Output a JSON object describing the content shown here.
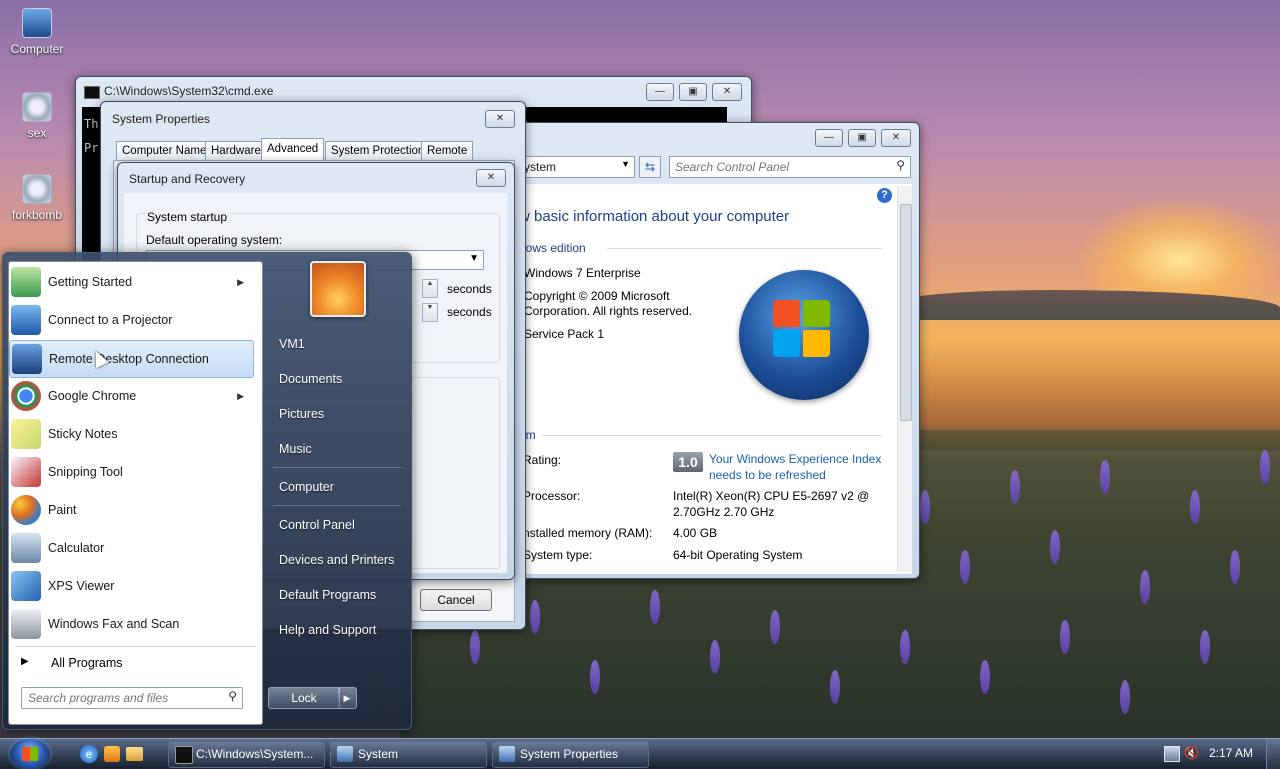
{
  "desktop": {
    "icons": [
      {
        "label": "Computer",
        "icon": "computer-icon"
      },
      {
        "label": "sex",
        "icon": "gear-icon"
      },
      {
        "label": "forkbomb",
        "icon": "gear-icon"
      }
    ]
  },
  "cmd": {
    "title": "C:\\Windows\\System32\\cmd.exe",
    "line1": "Th",
    "line2": "Pr"
  },
  "sysprops": {
    "title": "System Properties",
    "tabs": [
      "Computer Name",
      "Hardware",
      "Advanced",
      "System Protection",
      "Remote"
    ],
    "active_tab": "Advanced",
    "cancel": "Cancel"
  },
  "startup": {
    "title": "Startup and Recovery",
    "group": "System startup",
    "default_os_label": "Default operating system:",
    "unit1": "seconds",
    "unit2": "seconds"
  },
  "system_window": {
    "address": "ystem",
    "search_placeholder": "Search Control Panel",
    "heading": "w basic information about your computer",
    "edition_header": "dows edition",
    "edition": "Windows 7 Enterprise",
    "copyright": "Copyright © 2009 Microsoft Corporation.  All rights reserved.",
    "copyright_line1": "Copyright © 2009 Microsoft",
    "copyright_line2": "Corporation.  All rights reserved.",
    "service_pack": "Service Pack 1",
    "system_header": "em",
    "rating_label": "Rating:",
    "rating_score": "1.0",
    "rating_link_line1": "Your Windows Experience Index",
    "rating_link_line2": "needs to be refreshed",
    "processor_label": "Processor:",
    "processor_line1": "Intel(R) Xeon(R) CPU E5-2697 v2 @",
    "processor_line2": "2.70GHz   2.70 GHz",
    "memory_label": "nstalled memory (RAM):",
    "memory": "4.00 GB",
    "systype_label": "System type:",
    "systype": "64-bit Operating System"
  },
  "start_menu": {
    "programs": [
      {
        "label": "Getting Started",
        "icon": "getting-started-icon",
        "arrow": true
      },
      {
        "label": "Connect to a Projector",
        "icon": "projector-icon",
        "arrow": false
      },
      {
        "label": "Remote Desktop Connection",
        "icon": "remote-desktop-icon",
        "arrow": false
      },
      {
        "label": "Google Chrome",
        "icon": "chrome-icon",
        "arrow": true
      },
      {
        "label": "Sticky Notes",
        "icon": "sticky-notes-icon",
        "arrow": false
      },
      {
        "label": "Snipping Tool",
        "icon": "snipping-tool-icon",
        "arrow": false
      },
      {
        "label": "Paint",
        "icon": "paint-icon",
        "arrow": false
      },
      {
        "label": "Calculator",
        "icon": "calculator-icon",
        "arrow": false
      },
      {
        "label": "XPS Viewer",
        "icon": "xps-viewer-icon",
        "arrow": false
      },
      {
        "label": "Windows Fax and Scan",
        "icon": "fax-scan-icon",
        "arrow": false
      }
    ],
    "all_programs": "All Programs",
    "search_placeholder": "Search programs and files",
    "right_items": [
      "VM1",
      "Documents",
      "Pictures",
      "Music",
      "Computer",
      "Control Panel",
      "Devices and Printers",
      "Default Programs",
      "Help and Support"
    ],
    "lock": "Lock"
  },
  "taskbar": {
    "buttons": [
      {
        "label": "C:\\Windows\\System...",
        "icon": "cmd-icon"
      },
      {
        "label": "System",
        "icon": "system-icon"
      },
      {
        "label": "System Properties",
        "icon": "system-icon"
      }
    ],
    "time": "2:17 AM"
  }
}
